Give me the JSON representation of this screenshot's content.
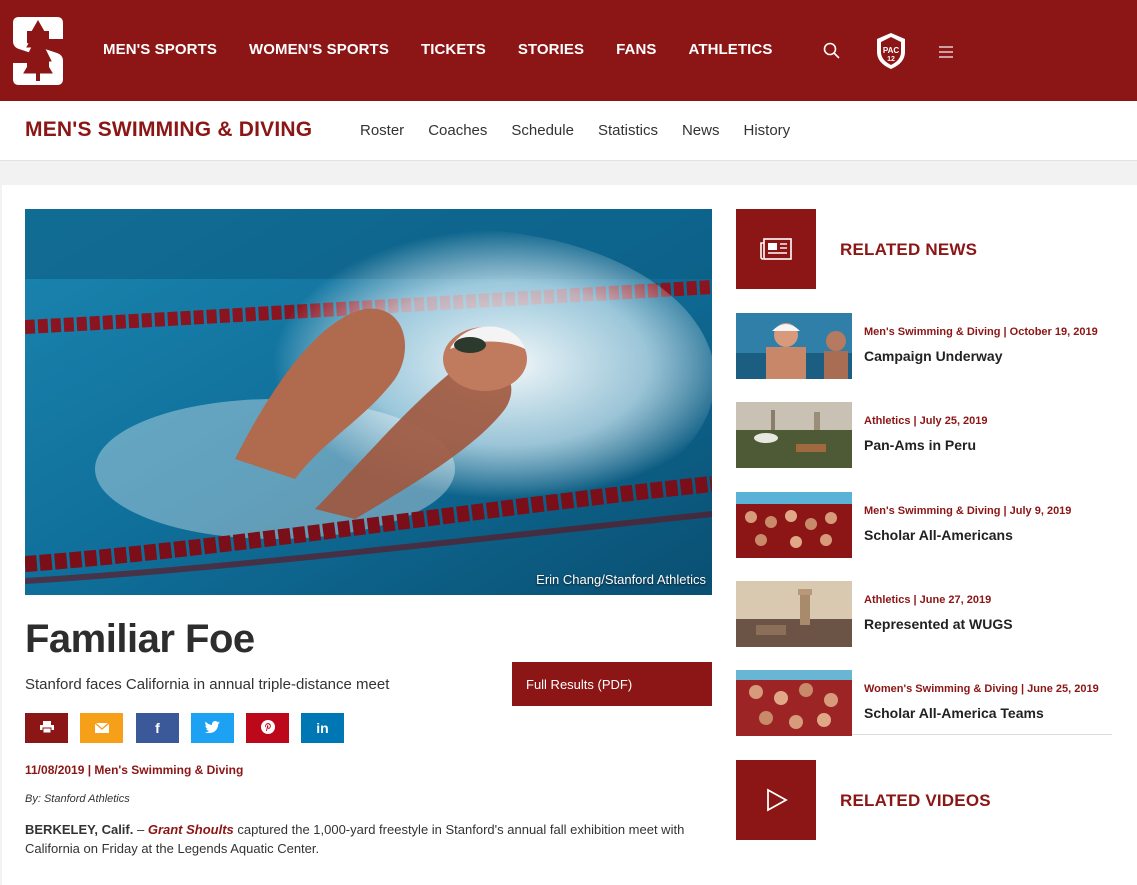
{
  "header": {
    "logo": "stanford-s-tree-logo",
    "nav": [
      "MEN'S SPORTS",
      "WOMEN'S SPORTS",
      "TICKETS",
      "STORIES",
      "FANS",
      "ATHLETICS"
    ],
    "icons": [
      "search-icon",
      "pac12-logo",
      "hamburger-menu-icon"
    ]
  },
  "subheader": {
    "sport": "MEN'S SWIMMING & DIVING",
    "nav": [
      "Roster",
      "Coaches",
      "Schedule",
      "Statistics",
      "News",
      "History"
    ]
  },
  "article": {
    "photo_credit": "Erin Chang/Stanford Athletics",
    "title": "Familiar Foe",
    "subtitle": "Stanford faces California in annual triple-distance meet",
    "results_button": "Full Results (PDF)",
    "share_icons": [
      "print-icon",
      "email-icon",
      "facebook-icon",
      "twitter-icon",
      "pinterest-icon",
      "linkedin-icon"
    ],
    "share_labels": {
      "facebook": "f",
      "linkedin": "in"
    },
    "date_sport": "11/08/2019 | Men's Swimming & Diving",
    "byline": "By: Stanford Athletics",
    "dateline": "BERKELEY, Calif.",
    "dash": " – ",
    "athlete": "Grant Shoults",
    "body_rest": " captured the 1,000-yard freestyle in Stanford's annual fall exhibition meet with California on Friday at the Legends Aquatic Center."
  },
  "sidebar": {
    "related_news_title": "RELATED NEWS",
    "related_videos_title": "RELATED VIDEOS",
    "news": [
      {
        "meta": "Men's Swimming & Diving | October 19, 2019",
        "title": "Campaign Underway"
      },
      {
        "meta": "Athletics | July 25, 2019",
        "title": "Pan-Ams in Peru"
      },
      {
        "meta": "Men's Swimming & Diving | July 9, 2019",
        "title": "Scholar All-Americans"
      },
      {
        "meta": "Athletics | June 27, 2019",
        "title": "Represented at WUGS"
      },
      {
        "meta": "Women's Swimming & Diving | June 25, 2019",
        "title": "Scholar All-America Teams"
      }
    ]
  },
  "colors": {
    "cardinal": "#8c1515",
    "email": "#f6a01a",
    "facebook": "#3b5998",
    "twitter": "#1da1f2",
    "pinterest": "#bd081c",
    "linkedin": "#0077b5"
  }
}
